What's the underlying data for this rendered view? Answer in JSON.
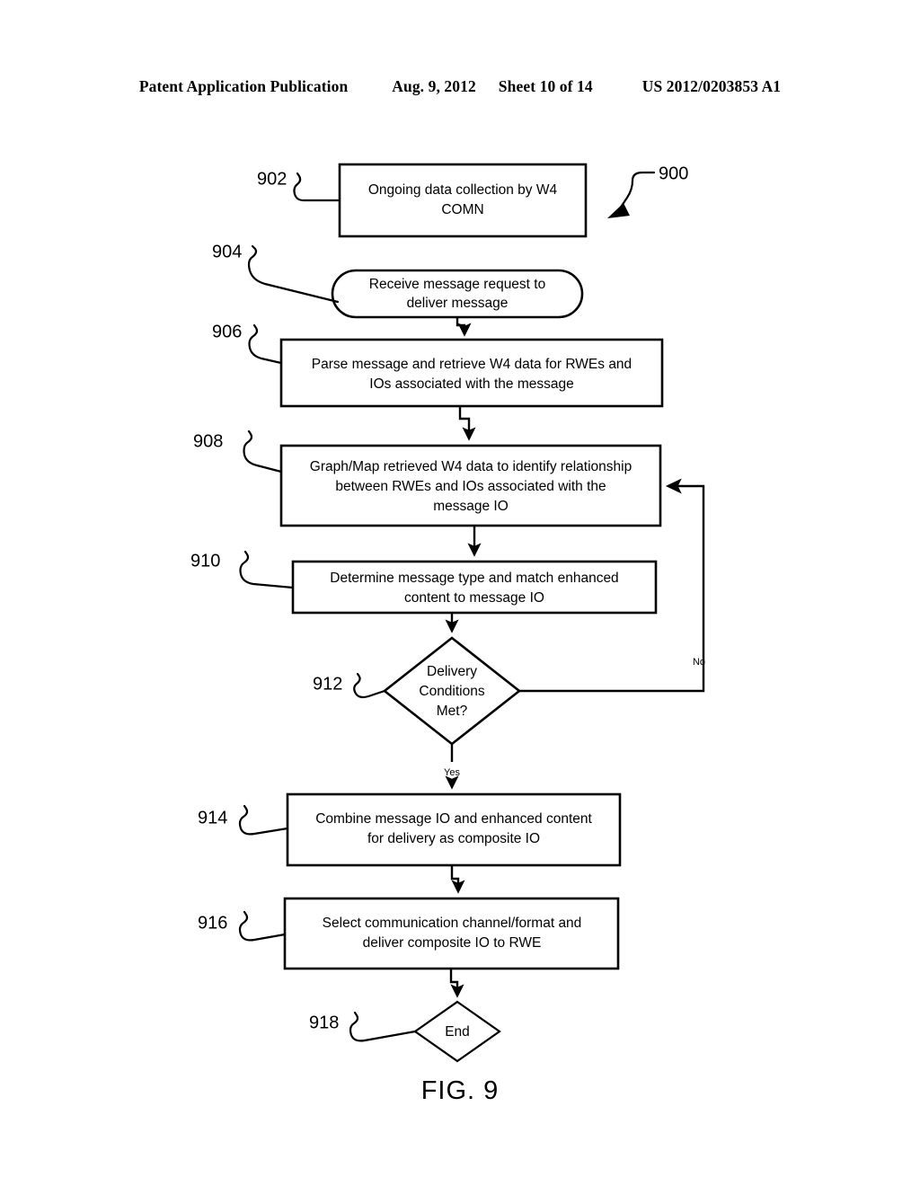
{
  "header": {
    "publication": "Patent Application Publication",
    "date": "Aug. 9, 2012",
    "sheet": "Sheet 10 of 14",
    "patent_number": "US 2012/0203853 A1"
  },
  "figure": {
    "caption": "FIG. 9",
    "diagram_ref": "900"
  },
  "flowchart": {
    "nodes": [
      {
        "ref": "902",
        "shape": "rect",
        "lines": [
          "Ongoing data collection by W4",
          "COMN"
        ]
      },
      {
        "ref": "904",
        "shape": "stadium",
        "lines": [
          "Receive message request to",
          "deliver message"
        ]
      },
      {
        "ref": "906",
        "shape": "rect",
        "lines": [
          "Parse message and retrieve W4 data for RWEs and",
          "IOs associated with the message"
        ]
      },
      {
        "ref": "908",
        "shape": "rect",
        "lines": [
          "Graph/Map retrieved W4 data to identify relationship",
          "between RWEs and IOs associated with the",
          "message IO"
        ]
      },
      {
        "ref": "910",
        "shape": "rect",
        "lines": [
          "Determine message type and match enhanced",
          "content to message IO"
        ]
      },
      {
        "ref": "912",
        "shape": "diamond",
        "lines": [
          "Delivery",
          "Conditions",
          "Met?"
        ]
      },
      {
        "ref": "914",
        "shape": "rect",
        "lines": [
          "Combine message IO and enhanced content",
          "for delivery as composite IO"
        ]
      },
      {
        "ref": "916",
        "shape": "rect",
        "lines": [
          "Select communication channel/format and",
          "deliver composite IO to RWE"
        ]
      },
      {
        "ref": "918",
        "shape": "diamond",
        "lines": [
          "End"
        ]
      }
    ],
    "branch_labels": {
      "no": "No",
      "yes": "Yes"
    }
  },
  "colors": {
    "ink": "#000000",
    "paper": "#ffffff"
  }
}
